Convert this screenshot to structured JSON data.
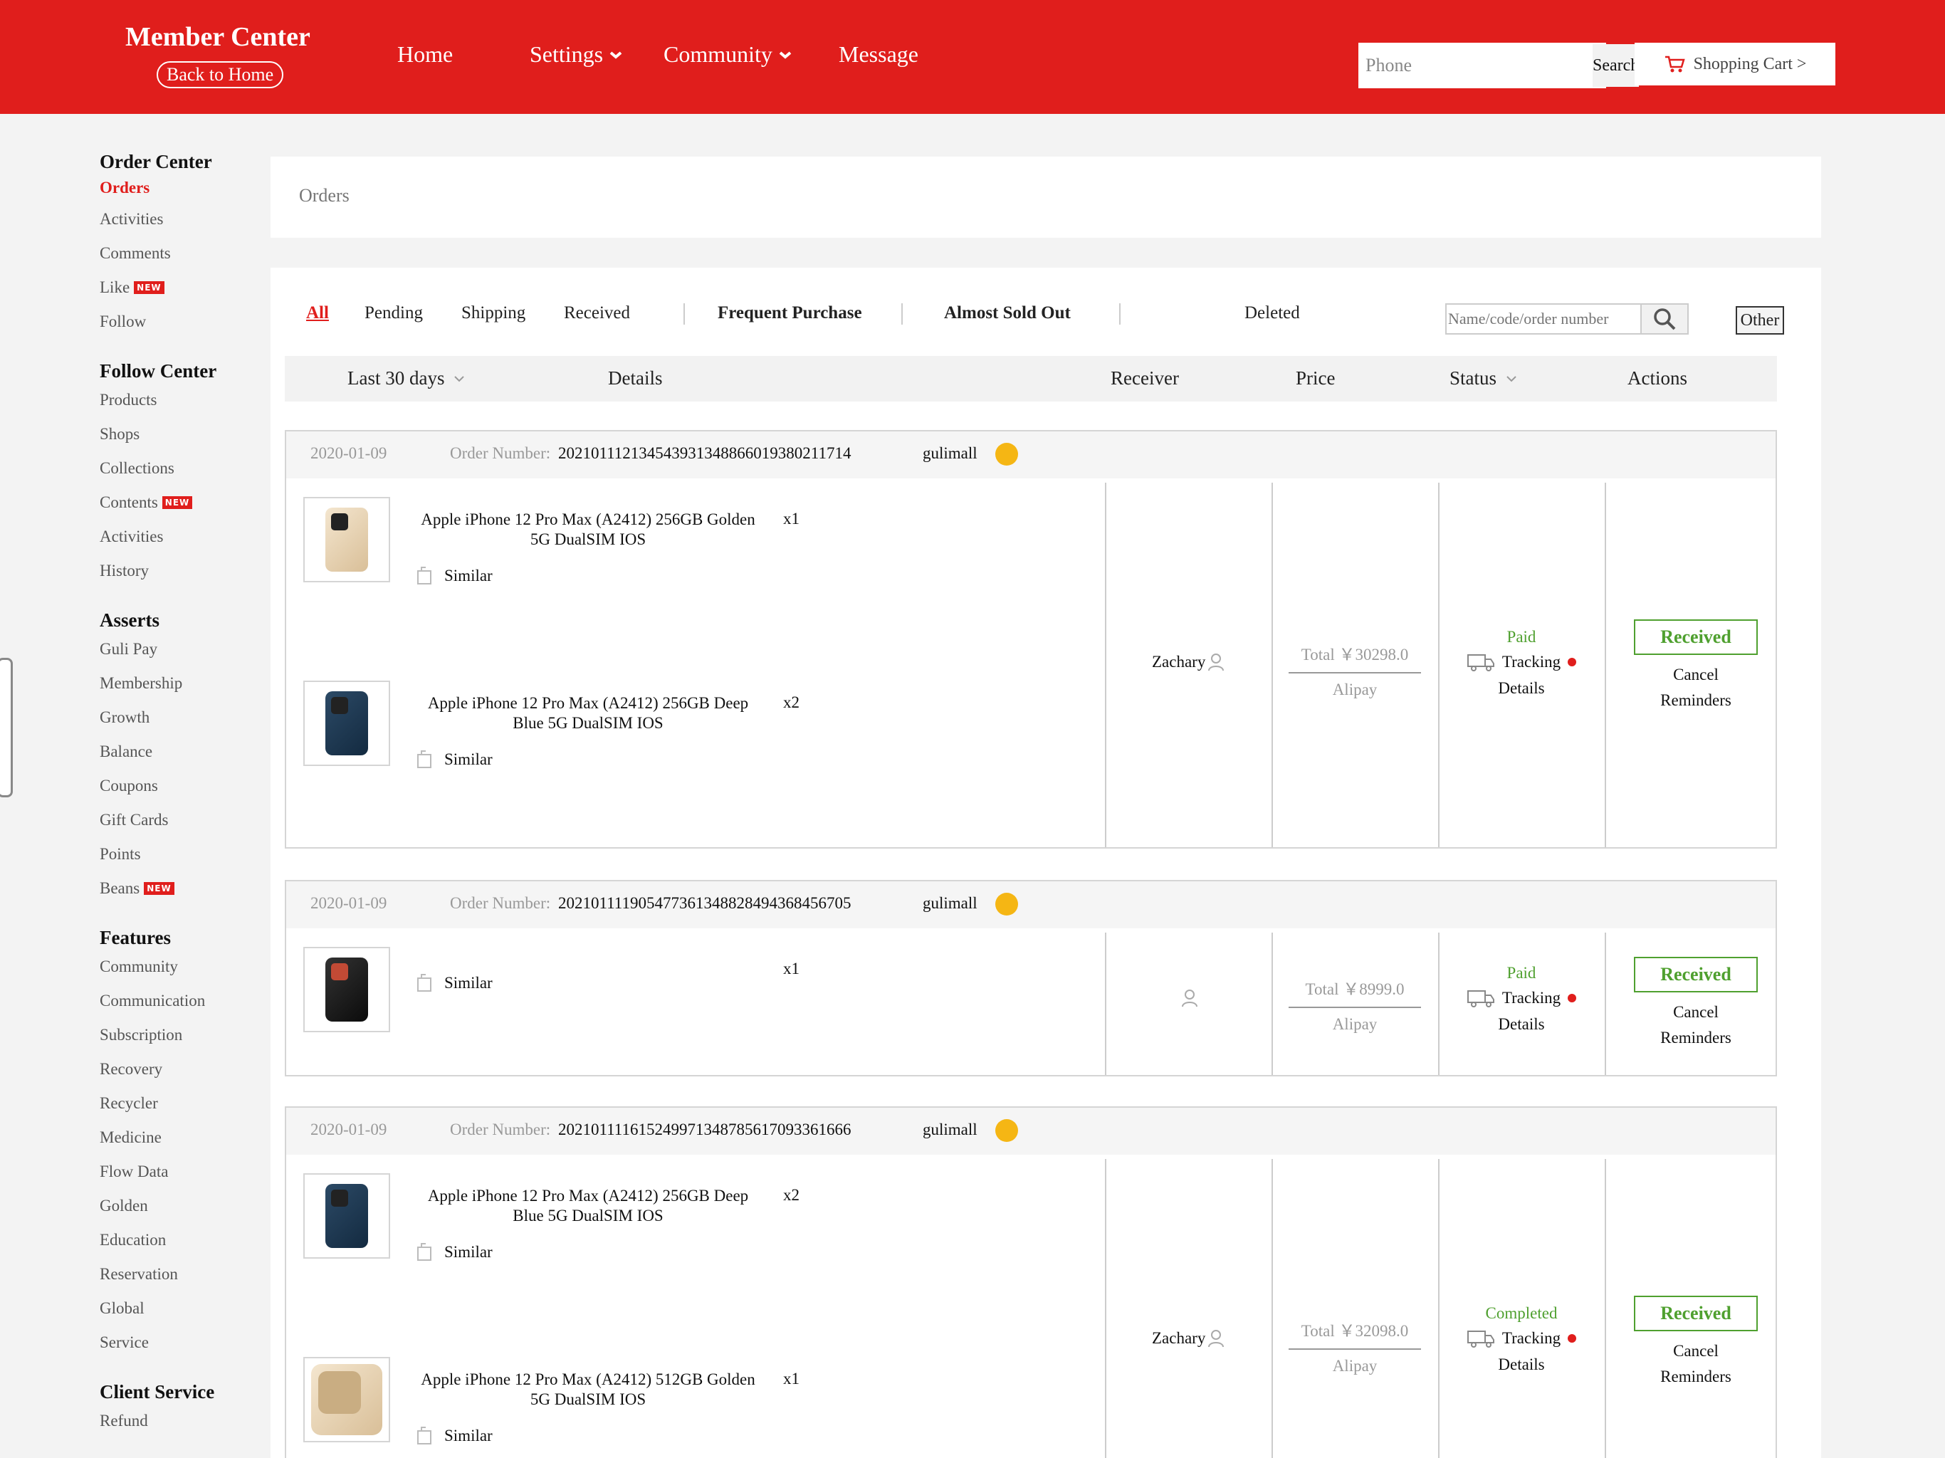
{
  "header": {
    "title": "Member Center",
    "back_home": "Back to Home",
    "nav": [
      {
        "label": "Home"
      },
      {
        "label": "Settings"
      },
      {
        "label": "Community"
      },
      {
        "label": "Message"
      }
    ],
    "search_value": "Phone",
    "search_button": "Search",
    "cart_label": "Shopping Cart >",
    "brand_color": "#e01e1c"
  },
  "sidebar": {
    "groups": [
      {
        "title": "Order Center",
        "items": [
          {
            "label": "Orders",
            "active": true
          },
          {
            "label": "Activities"
          },
          {
            "label": "Comments"
          },
          {
            "label": "Like",
            "badge": "NEW"
          },
          {
            "label": "Follow"
          }
        ]
      },
      {
        "title": "Follow Center",
        "items": [
          {
            "label": "Products"
          },
          {
            "label": "Shops"
          },
          {
            "label": "Collections"
          },
          {
            "label": "Contents",
            "badge": "NEW"
          },
          {
            "label": "Activities"
          },
          {
            "label": "History"
          }
        ]
      },
      {
        "title": "Asserts",
        "items": [
          {
            "label": "Guli Pay"
          },
          {
            "label": "Membership"
          },
          {
            "label": "Growth"
          },
          {
            "label": "Balance"
          },
          {
            "label": "Coupons"
          },
          {
            "label": "Gift Cards"
          },
          {
            "label": "Points"
          },
          {
            "label": "Beans",
            "badge": "NEW"
          }
        ]
      },
      {
        "title": "Features",
        "items": [
          {
            "label": "Community"
          },
          {
            "label": "Communication"
          },
          {
            "label": "Subscription"
          },
          {
            "label": "Recovery"
          },
          {
            "label": "Recycler"
          },
          {
            "label": "Medicine"
          },
          {
            "label": "Flow Data"
          },
          {
            "label": "Golden"
          },
          {
            "label": "Education"
          },
          {
            "label": "Reservation"
          },
          {
            "label": "Global"
          },
          {
            "label": "Service"
          }
        ]
      },
      {
        "title": "Client Service",
        "items": [
          {
            "label": "Refund"
          }
        ]
      }
    ]
  },
  "breadcrumb": "Orders",
  "tabs": {
    "all": "All",
    "pending": "Pending",
    "shipping": "Shipping",
    "received": "Received",
    "frequent": "Frequent Purchase",
    "almost": "Almost Sold Out",
    "deleted": "Deleted",
    "filter_placeholder": "Name/code/order number",
    "other": "Other"
  },
  "table_header": {
    "period": "Last 30 days",
    "details": "Details",
    "receiver": "Receiver",
    "price": "Price",
    "status": "Status",
    "actions": "Actions"
  },
  "orders": [
    {
      "date": "2020-01-09",
      "number_label": "Order Number:",
      "number": "202101112134543931348866019380211714",
      "shop": "gulimall",
      "items": [
        {
          "name": "Apple iPhone 12 Pro Max (A2412) 256GB Golden 5G DualSIM IOS",
          "qty": "x1",
          "similar": "Similar",
          "image": "iphone-gold"
        },
        {
          "name": "Apple iPhone 12 Pro Max (A2412) 256GB Deep Blue 5G DualSIM IOS",
          "qty": "x2",
          "similar": "Similar",
          "image": "iphone-blue"
        }
      ],
      "receiver": "Zachary",
      "total": "Total ￥30298.0",
      "payment": "Alipay",
      "status": "Paid",
      "tracking": "Tracking",
      "details": "Details",
      "action_received": "Received",
      "action_cancel": "Cancel",
      "action_reminders": "Reminders"
    },
    {
      "date": "2020-01-09",
      "number_label": "Order Number:",
      "number": "202101111905477361348828494368456705",
      "shop": "gulimall",
      "items": [
        {
          "name": "",
          "qty": "x1",
          "similar": "Similar",
          "image": "oneplus-black"
        }
      ],
      "receiver": "",
      "total": "Total ￥8999.0",
      "payment": "Alipay",
      "status": "Paid",
      "tracking": "Tracking",
      "details": "Details",
      "action_received": "Received",
      "action_cancel": "Cancel",
      "action_reminders": "Reminders"
    },
    {
      "date": "2020-01-09",
      "number_label": "Order Number:",
      "number": "202101111615249971348785617093361666",
      "shop": "gulimall",
      "items": [
        {
          "name": "Apple iPhone 12 Pro Max (A2412) 256GB Deep Blue 5G DualSIM IOS",
          "qty": "x2",
          "similar": "Similar",
          "image": "iphone-blue"
        },
        {
          "name": "Apple iPhone 12 Pro Max (A2412) 512GB Golden 5G DualSIM IOS",
          "qty": "x1",
          "similar": "Similar",
          "image": "iphone-gold-back"
        }
      ],
      "receiver": "Zachary",
      "total": "Total ￥32098.0",
      "payment": "Alipay",
      "status": "Completed",
      "tracking": "Tracking",
      "details": "Details",
      "action_received": "Received",
      "action_cancel": "Cancel",
      "action_reminders": "Reminders"
    }
  ]
}
